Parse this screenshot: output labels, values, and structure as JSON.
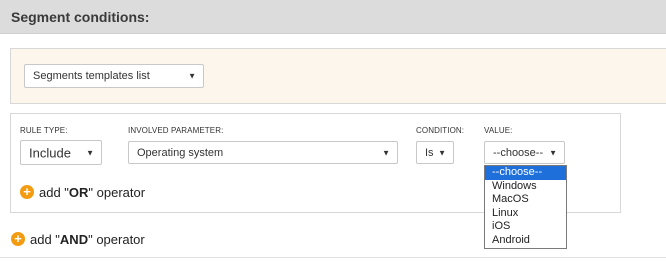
{
  "header": {
    "title": "Segment conditions:"
  },
  "templates": {
    "select_value": "Segments templates list"
  },
  "rule": {
    "rule_type_label": "RULE TYPE:",
    "rule_type_value": "Include",
    "parameter_label": "INVOLVED PARAMETER:",
    "parameter_value": "Operating system",
    "condition_label": "CONDITION:",
    "condition_value": "Is",
    "value_label": "VALUE:",
    "value_value": "--choose--"
  },
  "value_dropdown": {
    "options": [
      "--choose--",
      "Windows",
      "MacOS",
      "Linux",
      "iOS",
      "Android"
    ],
    "selected_index": 0
  },
  "or_operator": {
    "prefix": "add \"",
    "keyword": "OR",
    "suffix": "\" operator"
  },
  "and_operator": {
    "prefix": "add \"",
    "keyword": "AND",
    "suffix": "\" operator"
  },
  "colors": {
    "accent_orange": "#f39c12",
    "selected_blue": "#1e6fd9",
    "header_bg": "#dcdcdc",
    "templates_bg": "#fdf6ec"
  },
  "icons": {
    "plus": "plus-circle-icon",
    "caret": "caret-down-icon"
  }
}
